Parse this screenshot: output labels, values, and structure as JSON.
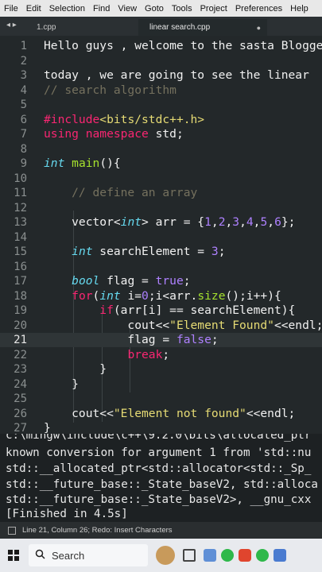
{
  "menu": [
    "File",
    "Edit",
    "Selection",
    "Find",
    "View",
    "Goto",
    "Tools",
    "Project",
    "Preferences",
    "Help"
  ],
  "tabs": {
    "nav": "◂ ▸",
    "items": [
      "1.cpp",
      "linear search.cpp"
    ],
    "modified_dot": "●"
  },
  "editor": {
    "lines": [
      {
        "n": "1",
        "t": "Hello guys , welcome to the sasta Blogge"
      },
      {
        "n": "2",
        "t": ""
      },
      {
        "n": "3",
        "t": "today , we are going to see the linear"
      },
      {
        "n": "4",
        "t": "// search algorithm"
      },
      {
        "n": "5",
        "t": ""
      },
      {
        "n": "6",
        "t": "#include<bits/stdc++.h>"
      },
      {
        "n": "7",
        "t": "using namespace std;"
      },
      {
        "n": "8",
        "t": ""
      },
      {
        "n": "9",
        "t": "int main(){"
      },
      {
        "n": "10",
        "t": ""
      },
      {
        "n": "11",
        "t": "    // define an array"
      },
      {
        "n": "12",
        "t": ""
      },
      {
        "n": "13",
        "t": "    vector<int> arr = {1,2,3,4,5,6};"
      },
      {
        "n": "14",
        "t": ""
      },
      {
        "n": "15",
        "t": "    int searchElement = 3;"
      },
      {
        "n": "16",
        "t": ""
      },
      {
        "n": "17",
        "t": "    bool flag = true;"
      },
      {
        "n": "18",
        "t": "    for(int i=0;i<arr.size();i++){"
      },
      {
        "n": "19",
        "t": "        if(arr[i] == searchElement){"
      },
      {
        "n": "20",
        "t": "            cout<<\"Element Found\"<<endl;"
      },
      {
        "n": "21",
        "t": "            flag = false;"
      },
      {
        "n": "22",
        "t": "            break;"
      },
      {
        "n": "23",
        "t": "        }"
      },
      {
        "n": "24",
        "t": "    }"
      },
      {
        "n": "25",
        "t": ""
      },
      {
        "n": "26",
        "t": "    cout<<\"Element not found\"<<endl;"
      },
      {
        "n": "27",
        "t": "}"
      }
    ]
  },
  "console": {
    "lines": [
      "c:\\mingw\\include\\c++\\9.2.0\\bits\\allocated_ptr",
      "known conversion for argument 1 from 'std::nu",
      "std::__allocated_ptr<std::allocator<std::_Sp_",
      "std::__future_base::_State_baseV2, std::alloca",
      "std::__future_base::_State_baseV2>, __gnu_cxx",
      "[Finished in 4.5s]"
    ]
  },
  "status": {
    "text": "Line 21, Column 26; Redo: Insert Characters"
  },
  "taskbar": {
    "search_placeholder": "Search"
  }
}
